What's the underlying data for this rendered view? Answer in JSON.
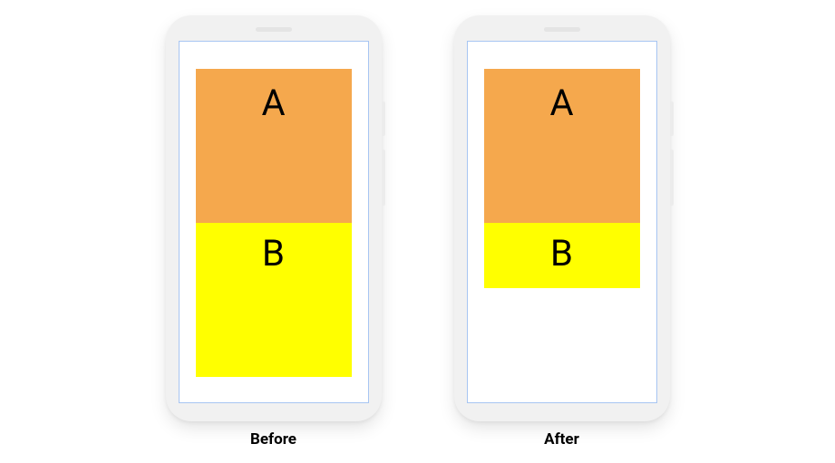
{
  "phones": {
    "before": {
      "label": "Before",
      "blockA": "A",
      "blockB": "B"
    },
    "after": {
      "label": "After",
      "blockA": "A",
      "blockB": "B"
    }
  },
  "colors": {
    "blockA": "#f5a84d",
    "blockB": "#ffff00",
    "phoneBody": "#f1f1f1",
    "screenBorder": "#a7c5f2"
  }
}
